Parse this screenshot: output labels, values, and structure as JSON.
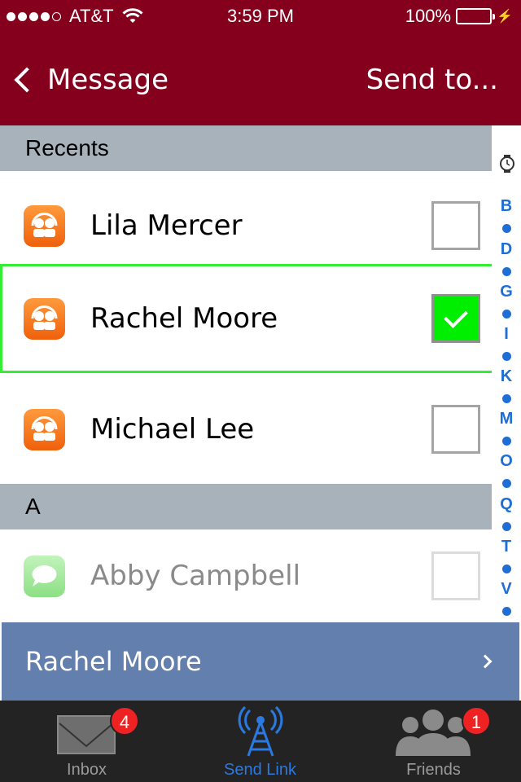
{
  "status_bar": {
    "carrier": "AT&T",
    "time": "3:59 PM",
    "battery": "100%",
    "signal_bars_filled": 4,
    "signal_bars_total": 5
  },
  "nav": {
    "back_label": "Message",
    "title": "Send to..."
  },
  "sections": [
    {
      "header": "Recents"
    },
    {
      "header": "A"
    }
  ],
  "contacts": [
    {
      "name": "Lila Mercer",
      "icon": "contacts-app-icon",
      "checked": false
    },
    {
      "name": "Rachel Moore",
      "icon": "contacts-app-icon",
      "checked": true
    },
    {
      "name": "Michael Lee",
      "icon": "contacts-app-icon",
      "checked": false
    },
    {
      "name": "Abby Campbell",
      "icon": "messages-app-icon",
      "checked": false
    }
  ],
  "index": [
    "B",
    "D",
    "G",
    "I",
    "K",
    "M",
    "O",
    "Q",
    "T",
    "V"
  ],
  "selection": {
    "label": "Rachel Moore"
  },
  "tabs": [
    {
      "label": "Inbox",
      "badge": "4",
      "icon": "envelope-icon"
    },
    {
      "label": "Send Link",
      "badge": "",
      "icon": "antenna-icon"
    },
    {
      "label": "Friends",
      "badge": "1",
      "icon": "people-icon"
    }
  ],
  "colors": {
    "nav_background": "#85001c",
    "section_header": "#a8b2bb",
    "selected_row_border": "#33ee33",
    "checkbox_checked": "#00ee00",
    "index_accent": "#1e6ed6",
    "selection_bar": "#637fae",
    "tab_bar": "#232323",
    "tab_active": "#2a7ae2",
    "badge": "#ee2222",
    "battery_fill": "#4cd964"
  }
}
